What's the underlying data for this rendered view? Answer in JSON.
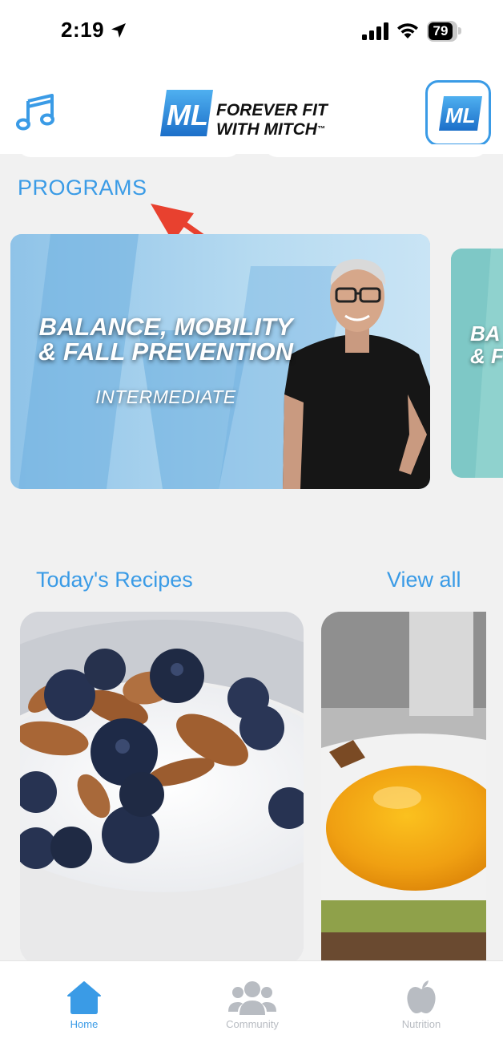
{
  "status_bar": {
    "time": "2:19",
    "battery": "79"
  },
  "header": {
    "logo_text": "FOREVER FIT\nWITH MITCH",
    "logo_trademark": "™",
    "logo_monogram": "ML"
  },
  "programs": {
    "title": "PROGRAMS",
    "cards": [
      {
        "title": "BALANCE, MOBILITY\n& FALL PREVENTION",
        "level": "INTERMEDIATE"
      },
      {
        "title": "BA\n& F"
      }
    ]
  },
  "recipes": {
    "title": "Today's Recipes",
    "view_all": "View all"
  },
  "tabs": [
    {
      "label": "Home",
      "icon": "home-icon",
      "active": true
    },
    {
      "label": "Community",
      "icon": "community-icon",
      "active": false
    },
    {
      "label": "Nutrition",
      "icon": "apple-icon",
      "active": false
    }
  ],
  "colors": {
    "accent": "#3a9be6",
    "inactive": "#b8bcc2",
    "annotation": "#e8412f"
  }
}
